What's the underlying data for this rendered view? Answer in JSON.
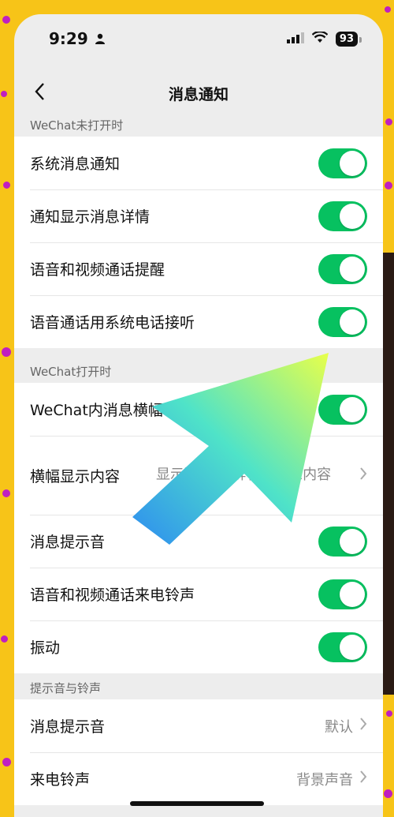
{
  "status": {
    "time": "9:29",
    "battery": "93"
  },
  "nav": {
    "title": "消息通知"
  },
  "sections": {
    "closed_header": "WeChat未打开时",
    "open_header": "WeChat打开时",
    "sound_header": "提示音与铃声"
  },
  "closed_rows": [
    {
      "label": "系统消息通知",
      "on": true
    },
    {
      "label": "通知显示消息详情",
      "on": true
    },
    {
      "label": "语音和视频通话提醒",
      "on": true
    },
    {
      "label": "语音通话用系统电话接听",
      "on": true
    }
  ],
  "open_rows": {
    "banner_label": "WeChat内消息横幅",
    "banner_content_label": "横幅显示内容",
    "banner_content_value": "显示联系人/群名及消息内容",
    "tone_label": "消息提示音",
    "ring_label": "语音和视频通话来电铃声",
    "vibrate_label": "振动"
  },
  "sound_rows": [
    {
      "label": "消息提示音",
      "value": "默认"
    },
    {
      "label": "来电铃声",
      "value": "背景声音"
    }
  ],
  "colors": {
    "toggle_on": "#07c160",
    "background": "#f7c418",
    "dots": "#c01fc0"
  },
  "icons": {
    "back": "chevron-left-icon",
    "chevron": "chevron-right-icon",
    "person": "person-icon",
    "signal": "signal-icon",
    "wifi": "wifi-icon"
  }
}
